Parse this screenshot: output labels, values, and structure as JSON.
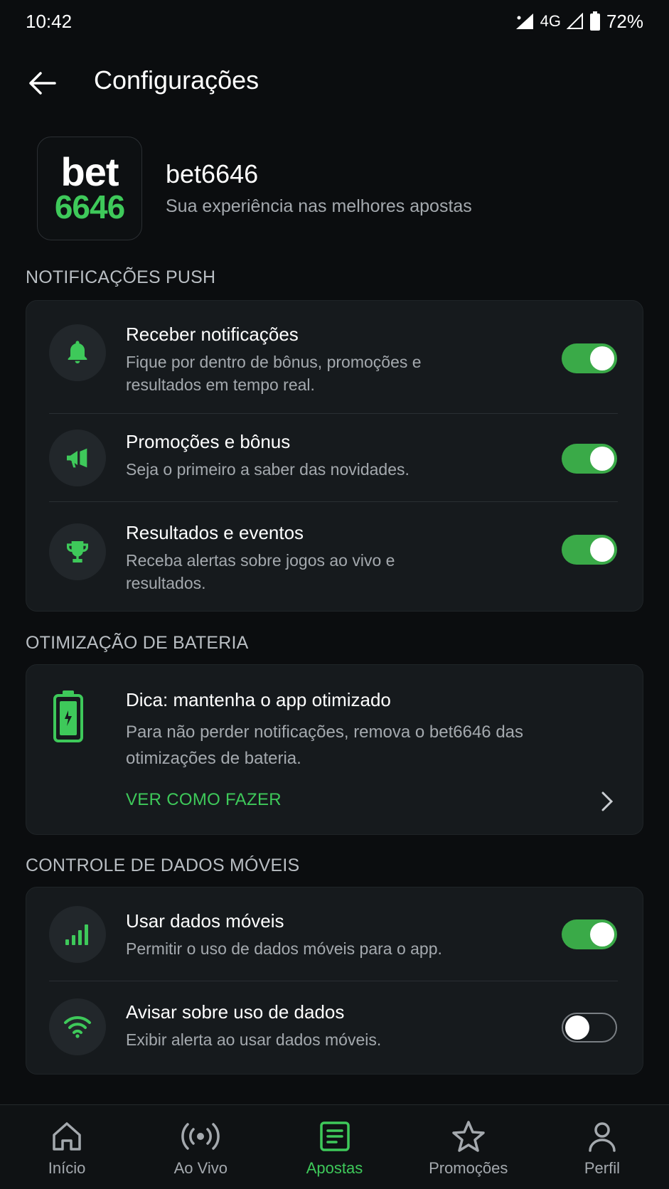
{
  "status": {
    "time": "10:42",
    "network": "4G",
    "battery": "72%"
  },
  "header": {
    "title": "Configurações"
  },
  "brand": {
    "logo_top": "bet",
    "logo_bottom": "6646",
    "name": "bet6646",
    "tagline": "Sua experiência nas melhores apostas"
  },
  "sections": {
    "push": {
      "title": "NOTIFICAÇÕES PUSH",
      "items": [
        {
          "title": "Receber notificações",
          "desc": "Fique por dentro de bônus, promoções e resultados em tempo real.",
          "enabled": true,
          "icon": "bell-icon"
        },
        {
          "title": "Promoções e bônus",
          "desc": "Seja o primeiro a saber das novidades.",
          "enabled": true,
          "icon": "megaphone-icon"
        },
        {
          "title": "Resultados e eventos",
          "desc": "Receba alertas sobre jogos ao vivo e resultados.",
          "enabled": true,
          "icon": "trophy-icon"
        }
      ]
    },
    "battery": {
      "title": "OTIMIZAÇÃO DE BATERIA",
      "tip_title": "Dica: mantenha o app otimizado",
      "tip_desc": "Para não perder notificações, remova o bet6646 das otimizações de bateria.",
      "link": "VER COMO FAZER",
      "icon": "battery-icon"
    },
    "data": {
      "title": "CONTROLE DE DADOS MÓVEIS",
      "items": [
        {
          "title": "Usar dados móveis",
          "desc": "Permitir o uso de dados móveis para o app.",
          "enabled": true,
          "icon": "signal-bars-icon"
        },
        {
          "title": "Avisar sobre uso de dados",
          "desc": "Exibir alerta ao usar dados móveis.",
          "enabled": false,
          "icon": "wifi-icon"
        }
      ]
    }
  },
  "nav": {
    "items": [
      {
        "label": "Início",
        "icon": "home-icon",
        "active": false
      },
      {
        "label": "Ao Vivo",
        "icon": "live-icon",
        "active": false
      },
      {
        "label": "Apostas",
        "icon": "bets-icon",
        "active": true
      },
      {
        "label": "Promoções",
        "icon": "star-icon",
        "active": false
      },
      {
        "label": "Perfil",
        "icon": "profile-icon",
        "active": false
      }
    ]
  },
  "colors": {
    "accent": "#3ec95a",
    "background": "#0b0d0f",
    "card": "#161a1d"
  }
}
